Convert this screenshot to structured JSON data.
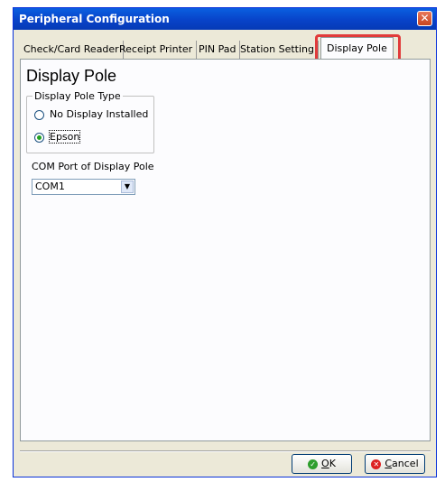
{
  "window": {
    "title": "Peripheral Configuration",
    "close_icon": "close-icon"
  },
  "tabs": [
    {
      "label": "Check/Card Reader"
    },
    {
      "label": "Receipt Printer"
    },
    {
      "label": "PIN Pad"
    },
    {
      "label": "Station Setting"
    },
    {
      "label": "Display Pole",
      "active": true
    }
  ],
  "panel": {
    "title": "Display Pole",
    "group": {
      "legend": "Display Pole Type",
      "options": [
        {
          "label": "No Display Installed",
          "checked": false
        },
        {
          "label": "Epson",
          "checked": true
        }
      ]
    },
    "com_port": {
      "label": "COM Port of Display Pole",
      "value": "COM1"
    }
  },
  "buttons": {
    "ok": {
      "accel": "O",
      "rest": "K",
      "icon": "check-icon"
    },
    "cancel": {
      "accel": "C",
      "rest": "ancel",
      "icon": "cancel-icon"
    }
  },
  "colors": {
    "highlight": "#e13b3b",
    "titlebar": "#0a5fe0"
  }
}
